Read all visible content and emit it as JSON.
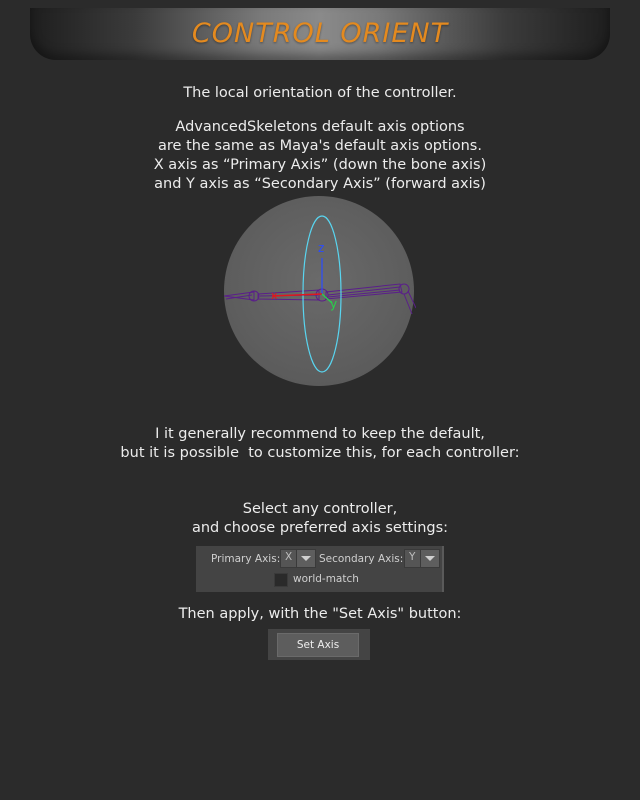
{
  "header": {
    "title": "CONTROL ORIENT"
  },
  "intro": {
    "line1": "The local orientation of the controller."
  },
  "description": {
    "lines": [
      "AdvancedSkeletons default axis options",
      "are the same as Maya's default axis options.",
      "X axis as “Primary Axis” (down the bone axis)",
      "and Y axis as “Secondary Axis” (forward axis)"
    ]
  },
  "illustration": {
    "axis_labels": {
      "z": "z",
      "x": "x",
      "y": "y"
    },
    "colors": {
      "z_axis": "#2a4cff",
      "x_axis": "#e0161e",
      "y_axis": "#27d24a",
      "ring": "#59d5f0",
      "skeleton": "#5a1f8a"
    }
  },
  "recommendation": {
    "lines": [
      "I it generally recommend to keep the default,",
      "but it is possible  to customize this, for each controller:"
    ]
  },
  "select_instructions": {
    "lines": [
      "Select any controller,",
      "and choose preferred axis settings:"
    ]
  },
  "axis_panel": {
    "primary_label": "Primary Axis:",
    "primary_value": "X",
    "secondary_label": "Secondary Axis:",
    "secondary_value": "Y",
    "world_match_label": "world-match",
    "world_match_checked": false
  },
  "apply_instructions": {
    "line1": "Then apply, with the \"Set Axis\" button:"
  },
  "set_axis_button": {
    "label": "Set Axis"
  }
}
